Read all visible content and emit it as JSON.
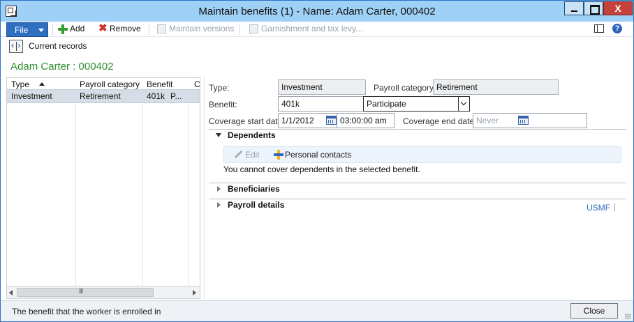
{
  "window": {
    "title": "Maintain benefits (1) - Name: Adam Carter, 000402",
    "close_glyph": "X"
  },
  "actionpane": {
    "file_label": "File",
    "add_label": "Add",
    "remove_label": "Remove",
    "maintain_versions_label": "Maintain versions",
    "garnishment_label": "Garnishment and tax levy...",
    "help_glyph": "?"
  },
  "records": {
    "current_records_label": "Current records",
    "record_title": "Adam Carter : 000402"
  },
  "grid": {
    "columns": [
      "Type",
      "Payroll category",
      "Benefit",
      "C"
    ],
    "rows": [
      {
        "type": "Investment",
        "payroll_category": "Retirement",
        "benefit": "401k",
        "extra": "P..."
      }
    ]
  },
  "details": {
    "type_label": "Type:",
    "type_value": "Investment",
    "payroll_category_label": "Payroll category:",
    "payroll_category_value": "Retirement",
    "benefit_label": "Benefit:",
    "benefit_value": "401k",
    "benefit_option": "Participate",
    "coverage_start_label": "Coverage start date:",
    "coverage_start_date": "1/1/2012",
    "coverage_start_time": "03:00:00 am",
    "coverage_end_label": "Coverage end date:",
    "coverage_end_value": "Never"
  },
  "fasttabs": {
    "dependents": {
      "title": "Dependents",
      "edit_label": "Edit",
      "personal_contacts_label": "Personal contacts",
      "message": "You cannot cover dependents in the selected benefit."
    },
    "beneficiaries": {
      "title": "Beneficiaries"
    },
    "payroll_details": {
      "title": "Payroll details",
      "company": "USMF"
    }
  },
  "status": {
    "text": "The benefit that the worker is enrolled in",
    "close_label": "Close"
  },
  "colors": {
    "title_bar": "#9fd0f6",
    "file_button": "#2f6fc0",
    "record_title": "#2f8f2f",
    "selected_row": "#d6dde6",
    "link": "#2a6bbf"
  }
}
